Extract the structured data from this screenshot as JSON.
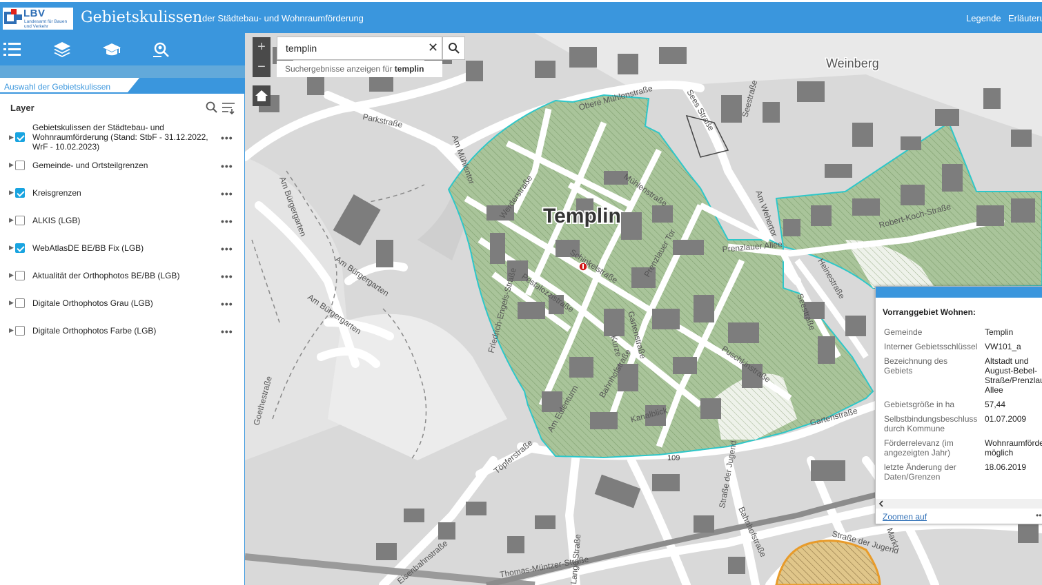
{
  "header": {
    "logo_abbr": "LBV",
    "logo_sub": "Landesamt für Bauen und Verkehr",
    "title": "Gebietskulissen",
    "subtitle": "der Städtebau- und Wohnraumförderung",
    "links": [
      "Legende",
      "Erläuteru"
    ]
  },
  "toolbar": {
    "icons": [
      "list-icon",
      "layers-icon",
      "graduation-cap-icon",
      "search-location-icon"
    ]
  },
  "tab": {
    "label": "Auswahl der Gebietskulissen"
  },
  "layer_panel": {
    "heading": "Layer",
    "more": "•••",
    "layers": [
      {
        "label": "Gebietskulissen der Städtebau- und Wohnraumförderung (Stand: StbF - 31.12.2022, WrF - 10.02.2023)",
        "checked": true
      },
      {
        "label": "Gemeinde- und Ortsteilgrenzen",
        "checked": false
      },
      {
        "label": "Kreisgrenzen",
        "checked": true
      },
      {
        "label": "ALKIS (LGB)",
        "checked": false
      },
      {
        "label": "WebAtlasDE BE/BB Fix (LGB)",
        "checked": true
      },
      {
        "label": "Aktualität der Orthophotos BE/BB (LGB)",
        "checked": false
      },
      {
        "label": "Digitale Orthophotos Grau (LGB)",
        "checked": false
      },
      {
        "label": "Digitale Orthophotos Farbe (LGB)",
        "checked": false
      }
    ]
  },
  "map": {
    "zoom_in": "+",
    "zoom_out": "−",
    "search": {
      "value": "templin",
      "clear": "✕"
    },
    "suggestion_prefix": "Suchergebnisse anzeigen für ",
    "suggestion_term": "templin",
    "labels": {
      "city": "Templin",
      "district": "Weinberg",
      "streets": [
        "Parkstraße",
        "Am Mühlentor",
        "Am Bürgergarten",
        "Am Bürgergarten",
        "Am Bürgergarten",
        "Goethestraße",
        "Werderstraße",
        "Mühlenstraße",
        "Schinkelstraße",
        "Pestalozzistraße",
        "Prenzlauer Tor",
        "Prenzlauer Allee",
        "Robert-Koch-Straße",
        "Heinestraße",
        "Seestraße",
        "Sees Straße",
        "Seestraße",
        "Am Wehertor",
        "Obere Mühlenstraße",
        "Puschkinstraße",
        "Bahnhofstraße",
        "Am Eulenturm",
        "Kanalblick",
        "Töpferstraße",
        "Friedrich-Engels-Straße",
        "Gartenstraße",
        "Straße der Jugend",
        "Bahnhofstraße",
        "Eisenbahnstraße",
        "Thomas-Müntzer-Straße",
        "Markt",
        "Kurze",
        "Gartenstraße",
        "Straße der Jugend",
        "Lange Straße"
      ],
      "road_number": "109"
    },
    "colors": {
      "area_fill": "#a9c49a",
      "area_border": "#2ec7c9",
      "background": "#d9d9d9"
    }
  },
  "popup": {
    "title": "Vorranggebiet Wohnen:",
    "rows": [
      {
        "key": "Gemeinde",
        "value": "Templin"
      },
      {
        "key": "Interner Gebietsschlüssel",
        "value": "VW101_a"
      },
      {
        "key": "Bezeichnung des Gebiets",
        "value": "Altstadt und August-Bebel-Straße/Prenzlauer Allee"
      },
      {
        "key": "Gebietsgröße in ha",
        "value": "57,44"
      },
      {
        "key": "Selbstbindungsbeschluss durch Kommune",
        "value": "01.07.2009"
      },
      {
        "key": "Förderrelevanz (im angezeigten Jahr)",
        "value": "Wohnraumförderung möglich"
      },
      {
        "key": "letzte Änderung der Daten/Grenzen",
        "value": "18.06.2019"
      }
    ],
    "zoom_link": "Zoomen auf",
    "more": "•••"
  }
}
